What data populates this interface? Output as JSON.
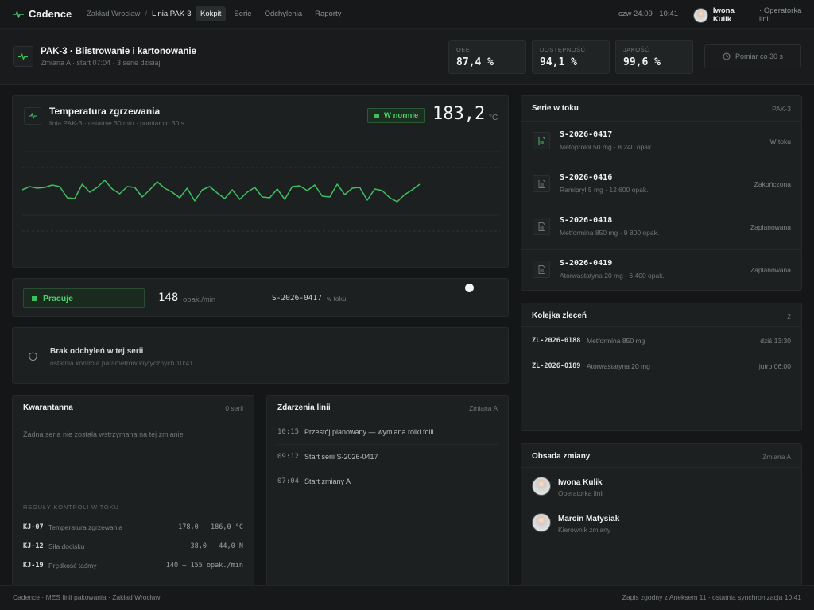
{
  "app": {
    "name": "Cadence"
  },
  "breadcrumb": {
    "plant": "Zakład Wrocław",
    "sep": "/",
    "line": "Linia PAK-3"
  },
  "nav": {
    "tabs": [
      "Kokpit",
      "Serie",
      "Odchylenia",
      "Raporty"
    ],
    "active": 0
  },
  "clock": "czw 24.09 · 10:41",
  "user": {
    "name": "Iwona Kulik",
    "role": "· Operatorka linii"
  },
  "line": {
    "title": "PAK-3 · Blistrowanie i kartonowanie",
    "subtitle": "Zmiana A · start 07:04 · 3 serie dzisiaj"
  },
  "kpis": [
    {
      "label": "OEE",
      "value": "87,4 %"
    },
    {
      "label": "DOSTĘPNOŚĆ",
      "value": "94,1 %"
    },
    {
      "label": "JAKOŚĆ",
      "value": "99,6 %"
    }
  ],
  "measure_button": "Pomiar co 30 s",
  "temperature": {
    "title": "Temperatura zgrzewania",
    "subtitle": "linia PAK-3 · ostatnie 30 min · pomiar co 30 s",
    "status": "W normie",
    "value": "183,2",
    "unit": "°C"
  },
  "chart_data": {
    "type": "line",
    "title": "Temperatura zgrzewania",
    "xlabel": "",
    "ylabel": "",
    "ylim": [
      175,
      190
    ],
    "grid": true,
    "values": [
      183.2,
      183.6,
      183.4,
      183.5,
      183.8,
      183.6,
      182.2,
      182.1,
      183.9,
      182.9,
      183.5,
      184.4,
      183.3,
      182.7,
      183.6,
      183.5,
      182.3,
      183.2,
      184.2,
      183.4,
      182.9,
      182.2,
      183.4,
      181.8,
      183.2,
      183.6,
      182.8,
      182.1,
      183.2,
      182.0,
      182.9,
      183.5,
      182.3,
      182.2,
      183.3,
      182.0,
      183.6,
      183.7,
      183.1,
      183.8,
      182.4,
      182.3,
      183.9,
      182.6,
      183.4,
      183.5,
      181.9,
      183.3,
      183.1,
      182.2,
      181.7,
      182.6,
      183.2,
      183.9
    ]
  },
  "status": {
    "state": "Pracuje",
    "rate": "148",
    "rate_unit": "opak./min",
    "batch": "S-2026-0417",
    "batch_state": "w toku"
  },
  "deviation": {
    "title": "Brak odchyleń w tej serii",
    "subtitle": "ostatnia kontrola parametrów krytycznych 10:41"
  },
  "quarantine": {
    "title": "Kwarantanna",
    "count": "0 serii",
    "empty": "Żadna seria nie została wstrzymana na tej zmianie",
    "rules_heading": "REGUŁY KONTROLI W TOKU",
    "rules": [
      {
        "code": "KJ-07",
        "name": "Temperatura zgrzewania",
        "range": "178,0 – 186,0 °C"
      },
      {
        "code": "KJ-12",
        "name": "Siła docisku",
        "range": "38,0 – 44,0 N"
      },
      {
        "code": "KJ-19",
        "name": "Prędkość taśmy",
        "range": "140 – 155 opak./min"
      }
    ]
  },
  "events": {
    "title": "Zdarzenia linii",
    "meta": "Zmiana A",
    "items": [
      {
        "time": "10:15",
        "text": "Przestój planowany — wymiana rolki folii"
      },
      {
        "time": "09:12",
        "text": "Start serii S-2026-0417"
      },
      {
        "time": "07:04",
        "text": "Start zmiany A"
      }
    ]
  },
  "series": {
    "title": "Serie w toku",
    "meta": "PAK-3",
    "items": [
      {
        "code": "S-2026-0417",
        "desc": "Metoprolol 50 mg · 8 240 opak.",
        "state": "W toku",
        "active": true
      },
      {
        "code": "S-2026-0416",
        "desc": "Ramipryl 5 mg · 12 600 opak.",
        "state": "Zakończona",
        "active": false
      },
      {
        "code": "S-2026-0418",
        "desc": "Metformina 850 mg · 9 800 opak.",
        "state": "Zaplanowana",
        "active": false
      },
      {
        "code": "S-2026-0419",
        "desc": "Atorwastatyna 20 mg · 6 400 opak.",
        "state": "Zaplanowana",
        "active": false
      }
    ]
  },
  "orders": {
    "title": "Kolejka zleceń",
    "count": "2",
    "items": [
      {
        "code": "ZL-2026-0188",
        "name": "Metformina 850 mg",
        "time": "dziś 13:30"
      },
      {
        "code": "ZL-2026-0189",
        "name": "Atorwastatyna 20 mg",
        "time": "jutro 06:00"
      }
    ]
  },
  "crew": {
    "title": "Obsada zmiany",
    "meta": "Zmiana A",
    "items": [
      {
        "name": "Iwona Kulik",
        "role": "Operatorka linii"
      },
      {
        "name": "Marcin Matysiak",
        "role": "Kierownik zmiany"
      }
    ]
  },
  "footer": {
    "left": "Cadence · MES linii pakowania · Zakład Wrocław",
    "right": "Zapis zgodny z Aneksem 11 · ostatnia synchronizacja 10:41"
  },
  "colors": {
    "accent": "#3fbf5f",
    "background": "#141617",
    "panel": "#1d2021"
  }
}
